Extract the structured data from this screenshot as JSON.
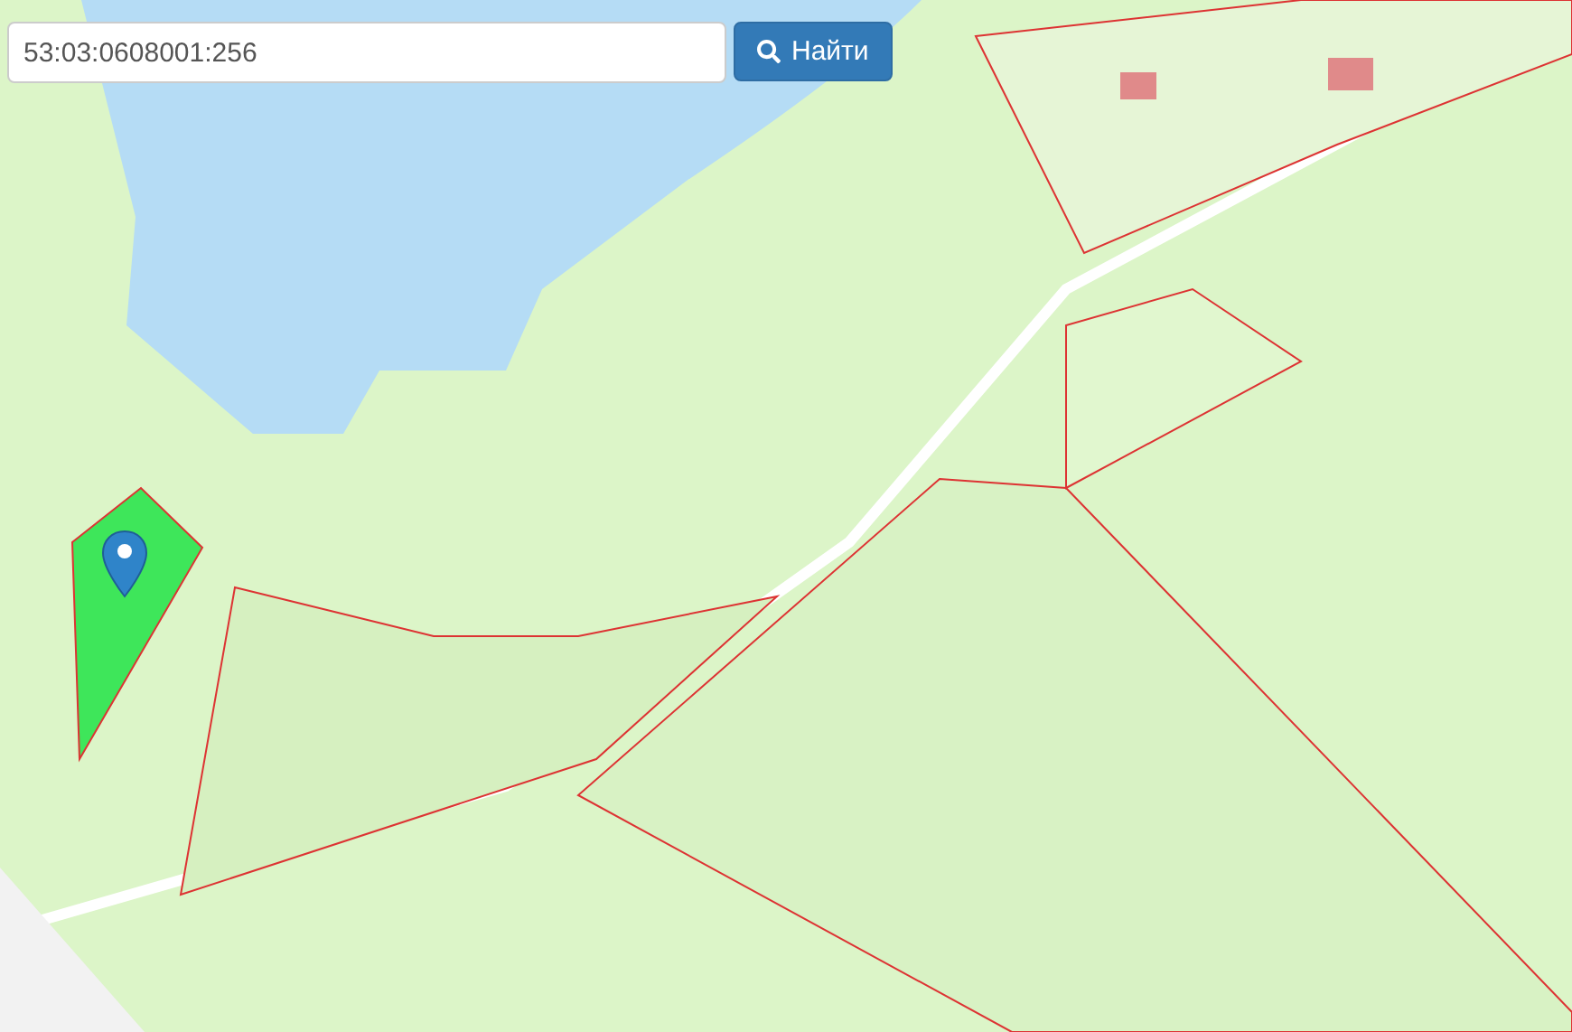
{
  "search": {
    "value": "53:03:0608001:256"
  },
  "button": {
    "label": "Найти"
  }
}
